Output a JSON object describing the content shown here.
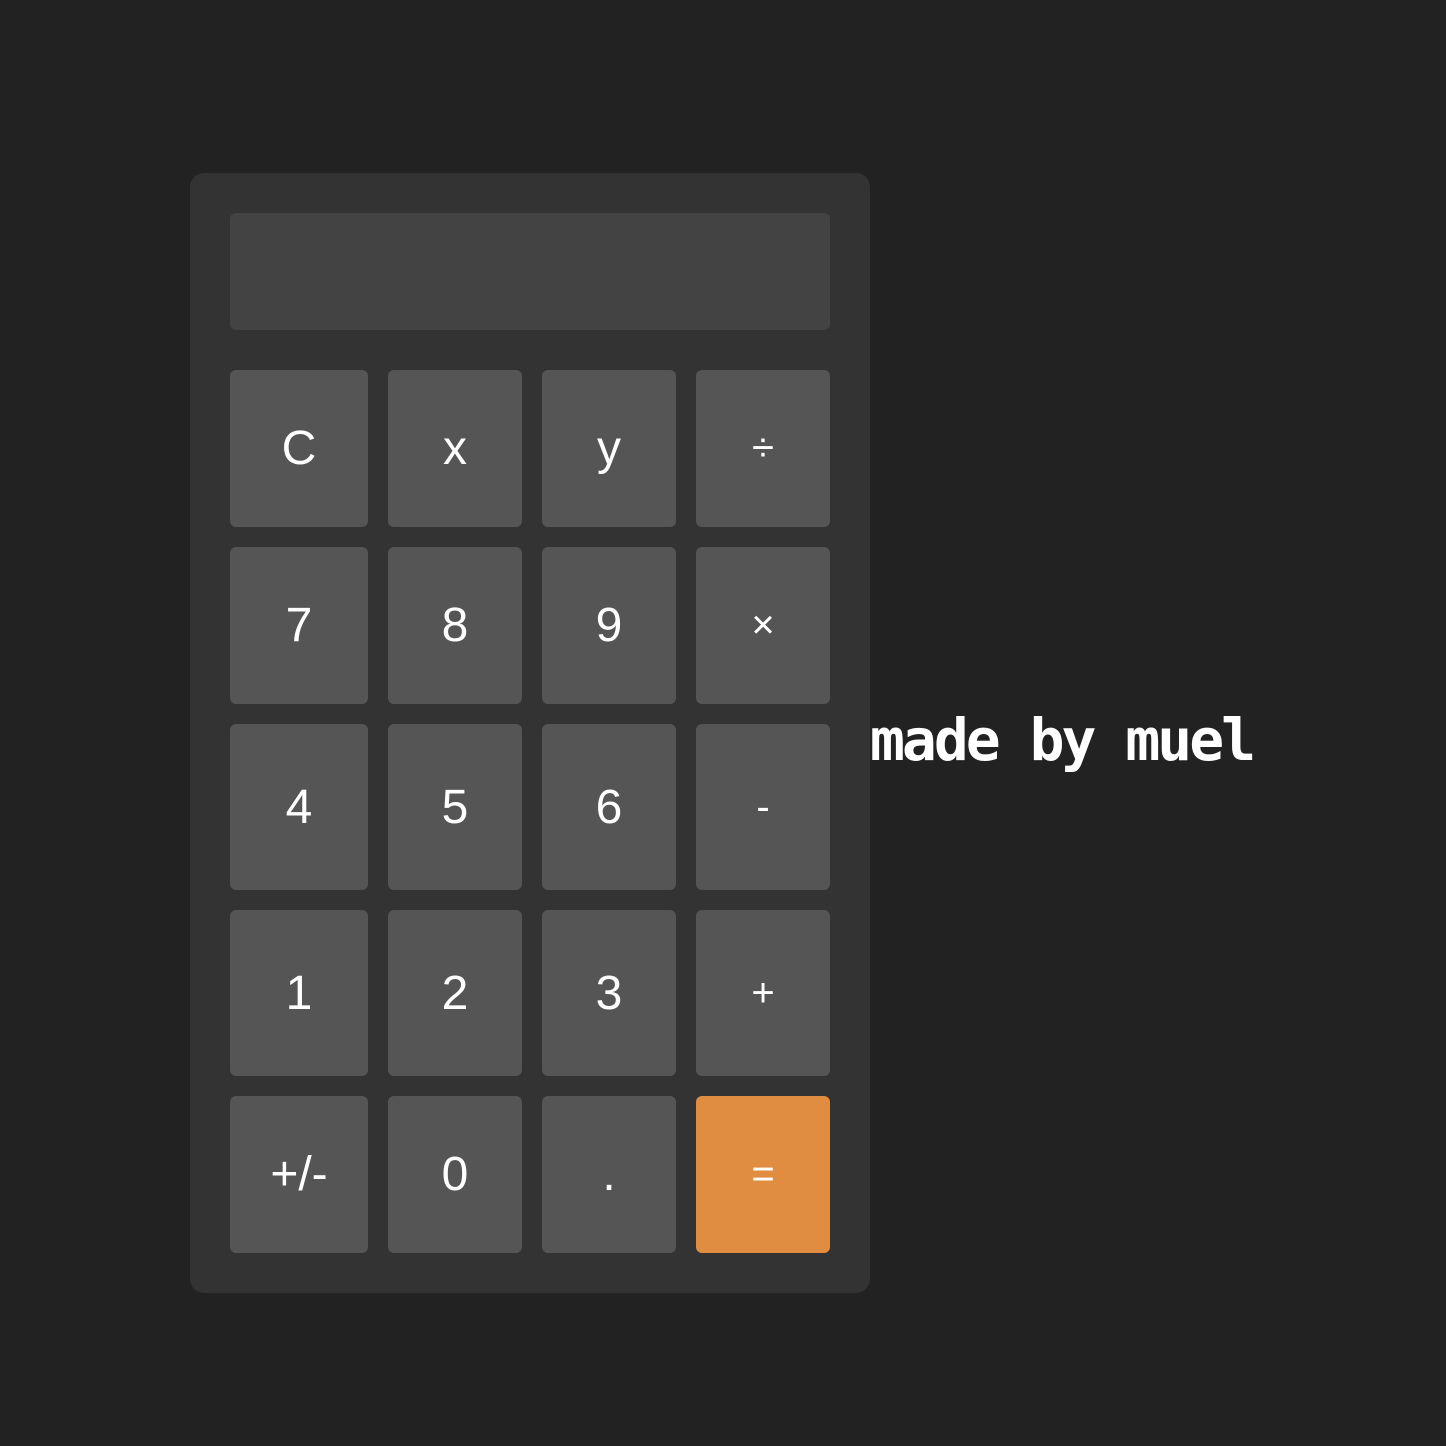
{
  "display": {
    "value": ""
  },
  "keys": {
    "row1": [
      "C",
      "x",
      "y",
      "÷"
    ],
    "row2": [
      "7",
      "8",
      "9",
      "×"
    ],
    "row3": [
      "4",
      "5",
      "6",
      "-"
    ],
    "row4": [
      "1",
      "2",
      "3",
      "+"
    ],
    "row5": [
      "+/-",
      "0",
      ".",
      "="
    ]
  },
  "credit": "made by muel",
  "colors": {
    "background": "#222222",
    "panel": "#333333",
    "display": "#434343",
    "key": "#555555",
    "equals_key": "#e08d42",
    "text": "#ffffff"
  }
}
